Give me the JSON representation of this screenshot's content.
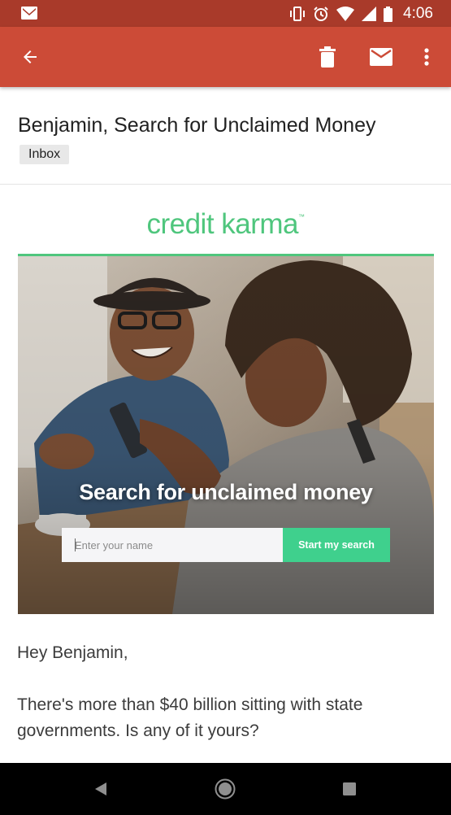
{
  "status_bar": {
    "time": "4:06",
    "icons": [
      "gmail-notification-icon",
      "vibrate-icon",
      "alarm-icon",
      "wifi-icon",
      "cellular-signal-icon",
      "battery-icon"
    ]
  },
  "app_bar": {
    "icons": [
      "back-arrow-icon",
      "delete-icon",
      "mark-unread-icon",
      "more-vert-icon"
    ],
    "color": "#cc4b37"
  },
  "email": {
    "subject": "Benjamin, Search for Unclaimed Money",
    "label": "Inbox"
  },
  "brand": {
    "name": "credit karma",
    "trademark": "™",
    "color": "#4fc67d"
  },
  "hero": {
    "title": "Search for unclaimed money",
    "input_placeholder": "Enter your name",
    "button_label": "Start my search",
    "button_color": "#3fd08d"
  },
  "body": {
    "greeting": "Hey Benjamin,",
    "paragraph": "There's more than $40 billion sitting with state governments. Is any of it yours?"
  },
  "nav_bar": {
    "icons": [
      "nav-back-icon",
      "nav-home-icon",
      "nav-recents-icon"
    ]
  }
}
